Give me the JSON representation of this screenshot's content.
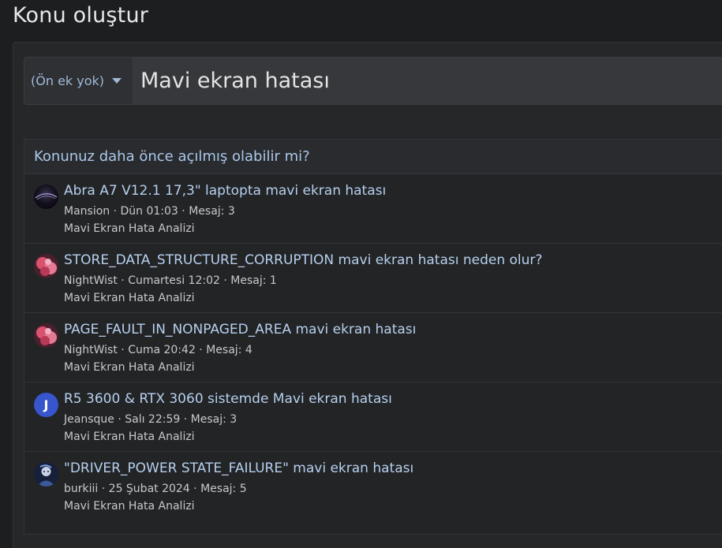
{
  "page": {
    "title": "Konu oluştur"
  },
  "form": {
    "prefix_label": "(Ön ek yok)",
    "title_value": "Mavi ekran hatası"
  },
  "similar": {
    "heading": "Konunuz daha önce açılmış olabilir mi?",
    "threads": [
      {
        "title": "Abra A7 V12.1 17,3\" laptopta mavi ekran hatası",
        "author": "Mansion",
        "date": "Dün 01:03",
        "replies": "Mesaj: 3",
        "forum": "Mavi Ekran Hata Analizi",
        "avatar": "avatar-image"
      },
      {
        "title": "STORE_DATA_STRUCTURE_CORRUPTION mavi ekran hatası neden olur?",
        "author": "NightWist",
        "date": "Cumartesi 12:02",
        "replies": "Mesaj: 1",
        "forum": "Mavi Ekran Hata Analizi",
        "avatar": "avatar-image"
      },
      {
        "title": "PAGE_FAULT_IN_NONPAGED_AREA mavi ekran hatası",
        "author": "NightWist",
        "date": "Cuma 20:42",
        "replies": "Mesaj: 4",
        "forum": "Mavi Ekran Hata Analizi",
        "avatar": "avatar-image"
      },
      {
        "title": "R5 3600 & RTX 3060 sistemde Mavi ekran hatası",
        "author": "Jeansque",
        "date": "Salı 22:59",
        "replies": "Mesaj: 3",
        "forum": "Mavi Ekran Hata Analizi",
        "avatar_letter": "J"
      },
      {
        "title": "\"DRIVER_POWER STATE_FAILURE\" mavi ekran hatası",
        "author": "burkiii",
        "date": "25 Şubat 2024",
        "replies": "Mesaj: 5",
        "forum": "Mavi Ekran Hata Analizi",
        "avatar": "avatar-image"
      }
    ]
  },
  "separator": " · ",
  "colors": {
    "background": "#1d1e20",
    "panel": "#262729",
    "link": "#b6d0ee",
    "heading": "#a9c8ea",
    "avatar_letter_bg": "#3755cc"
  }
}
